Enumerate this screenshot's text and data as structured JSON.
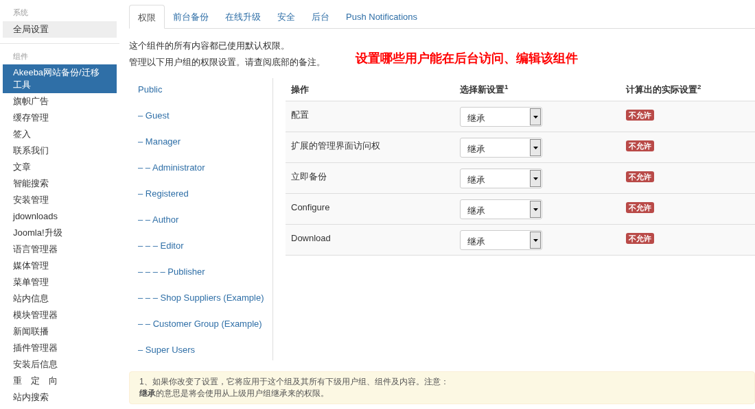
{
  "sidebar": {
    "sections": [
      {
        "heading": "系统",
        "items": [
          {
            "label": "全局设置",
            "selected": false,
            "hover": true
          }
        ]
      },
      {
        "heading": "组件",
        "items": [
          {
            "label": "Akeeba网站备份/迁移工具",
            "selected": true,
            "hover": false
          },
          {
            "label": "旗帜广告",
            "selected": false,
            "hover": false
          },
          {
            "label": "缓存管理",
            "selected": false,
            "hover": false
          },
          {
            "label": "签入",
            "selected": false,
            "hover": false
          },
          {
            "label": "联系我们",
            "selected": false,
            "hover": false
          },
          {
            "label": "文章",
            "selected": false,
            "hover": false
          },
          {
            "label": "智能搜索",
            "selected": false,
            "hover": false
          },
          {
            "label": "安装管理",
            "selected": false,
            "hover": false
          },
          {
            "label": "jdownloads",
            "selected": false,
            "hover": false
          },
          {
            "label": "Joomla!升级",
            "selected": false,
            "hover": false
          },
          {
            "label": "语言管理器",
            "selected": false,
            "hover": false
          },
          {
            "label": "媒体管理",
            "selected": false,
            "hover": false
          },
          {
            "label": "菜单管理",
            "selected": false,
            "hover": false
          },
          {
            "label": "站内信息",
            "selected": false,
            "hover": false
          },
          {
            "label": "模块管理器",
            "selected": false,
            "hover": false
          },
          {
            "label": "新闻联播",
            "selected": false,
            "hover": false
          },
          {
            "label": "插件管理器",
            "selected": false,
            "hover": false
          },
          {
            "label": "安装后信息",
            "selected": false,
            "hover": false
          },
          {
            "label": "重　定　向",
            "selected": false,
            "hover": false
          },
          {
            "label": "站内搜索",
            "selected": false,
            "hover": false
          }
        ]
      }
    ]
  },
  "tabs": [
    {
      "label": "权限",
      "selected": true
    },
    {
      "label": "前台备份",
      "selected": false
    },
    {
      "label": "在线升级",
      "selected": false
    },
    {
      "label": "安全",
      "selected": false
    },
    {
      "label": "后台",
      "selected": false
    },
    {
      "label": "Push Notifications",
      "selected": false
    }
  ],
  "intro": [
    "这个组件的所有内容都已使用默认权限。",
    "管理以下用户组的权限设置。请查阅底部的备注。"
  ],
  "annotation": "设置哪些用户能在后台访问、编辑该组件",
  "groups": [
    "Public",
    "– Guest",
    "– Manager",
    "– – Administrator",
    "– Registered",
    "– – Author",
    "– – – Editor",
    "– – – – Publisher",
    "– – – Shop Suppliers (Example)",
    "– – Customer Group (Example)",
    "– Super Users"
  ],
  "table": {
    "columns": [
      "操作",
      "选择新设置$^{1}$",
      "计算出的实际设置$^{2}$"
    ],
    "rows": [
      {
        "action": "配置",
        "setting": "继承",
        "result": "不允许"
      },
      {
        "action": "扩展的管理界面访问权",
        "setting": "继承",
        "result": "不允许"
      },
      {
        "action": "立即备份",
        "setting": "继承",
        "result": "不允许"
      },
      {
        "action": "Configure",
        "setting": "继承",
        "result": "不允许"
      },
      {
        "action": "Download",
        "setting": "继承",
        "result": "不允许"
      }
    ]
  },
  "notes": [
    "1、如果你改变了设置，它将应用于这个组及其所有下级用户组、组件及内容。注意：",
    "**继承**的意思是将会使用从上级用户组继承来的权限。"
  ]
}
